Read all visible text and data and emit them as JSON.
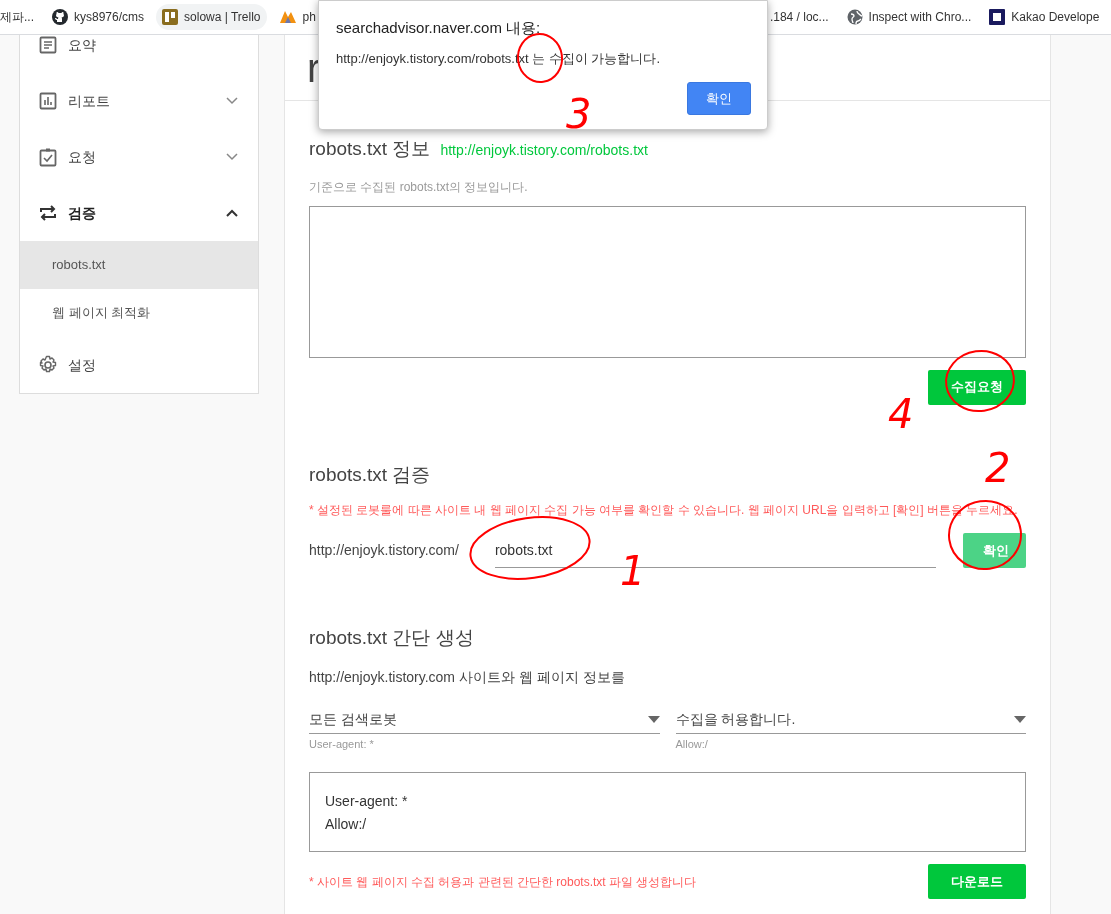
{
  "bookmarks": [
    {
      "label": "제파..."
    },
    {
      "label": "kys8976/cms"
    },
    {
      "label": "solowa | Trello"
    },
    {
      "label": "ph"
    },
    {
      "label": ".184 / loc..."
    },
    {
      "label": "Inspect with Chro..."
    },
    {
      "label": "Kakao Develope"
    }
  ],
  "sidebar": {
    "items": [
      {
        "label": "요약"
      },
      {
        "label": "리포트",
        "expanded": false
      },
      {
        "label": "요청",
        "expanded": false
      },
      {
        "label": "검증",
        "expanded": true,
        "children": [
          {
            "label": "robots.txt",
            "selected": true
          },
          {
            "label": "웹 페이지 최적화",
            "selected": false
          }
        ]
      },
      {
        "label": "설정"
      }
    ]
  },
  "page_title": "r",
  "info_section": {
    "title": "robots.txt 정보",
    "url": "http://enjoyk.tistory.com/robots.txt",
    "description": "기준으로 수집된 robots.txt의 정보입니다.",
    "button": "수집요청"
  },
  "check_section": {
    "title": "robots.txt 검증",
    "note": "* 설정된 로봇룰에 따른 사이트 내 웹 페이지 수집 가능 여부를 확인할 수 있습니다. 웹 페이지 URL을 입력하고 [확인] 버튼을 누르세요.",
    "prefix": "http://enjoyk.tistory.com/",
    "value": "robots.txt",
    "button": "확인"
  },
  "generate_section": {
    "title": "robots.txt 간단 생성",
    "subtitle": "http://enjoyk.tistory.com 사이트와 웹 페이지 정보를",
    "selects": [
      {
        "value": "모든 검색로봇",
        "caption": "User-agent: *"
      },
      {
        "value": "수집을 허용합니다.",
        "caption": "Allow:/"
      }
    ],
    "output_lines": [
      "User-agent: *",
      "Allow:/"
    ],
    "note": "* 사이트 웹 페이지 수집 허용과 관련된 간단한 robots.txt 파일 생성합니다",
    "button": "다운로드"
  },
  "dialog": {
    "title": "searchadvisor.naver.com 내용:",
    "message": "http://enjoyk.tistory.com/robots.txt 는 수집이 가능합니다.",
    "button": "확인"
  },
  "annotations": [
    {
      "number": "1"
    },
    {
      "number": "2"
    },
    {
      "number": "3"
    },
    {
      "number": "4"
    }
  ]
}
